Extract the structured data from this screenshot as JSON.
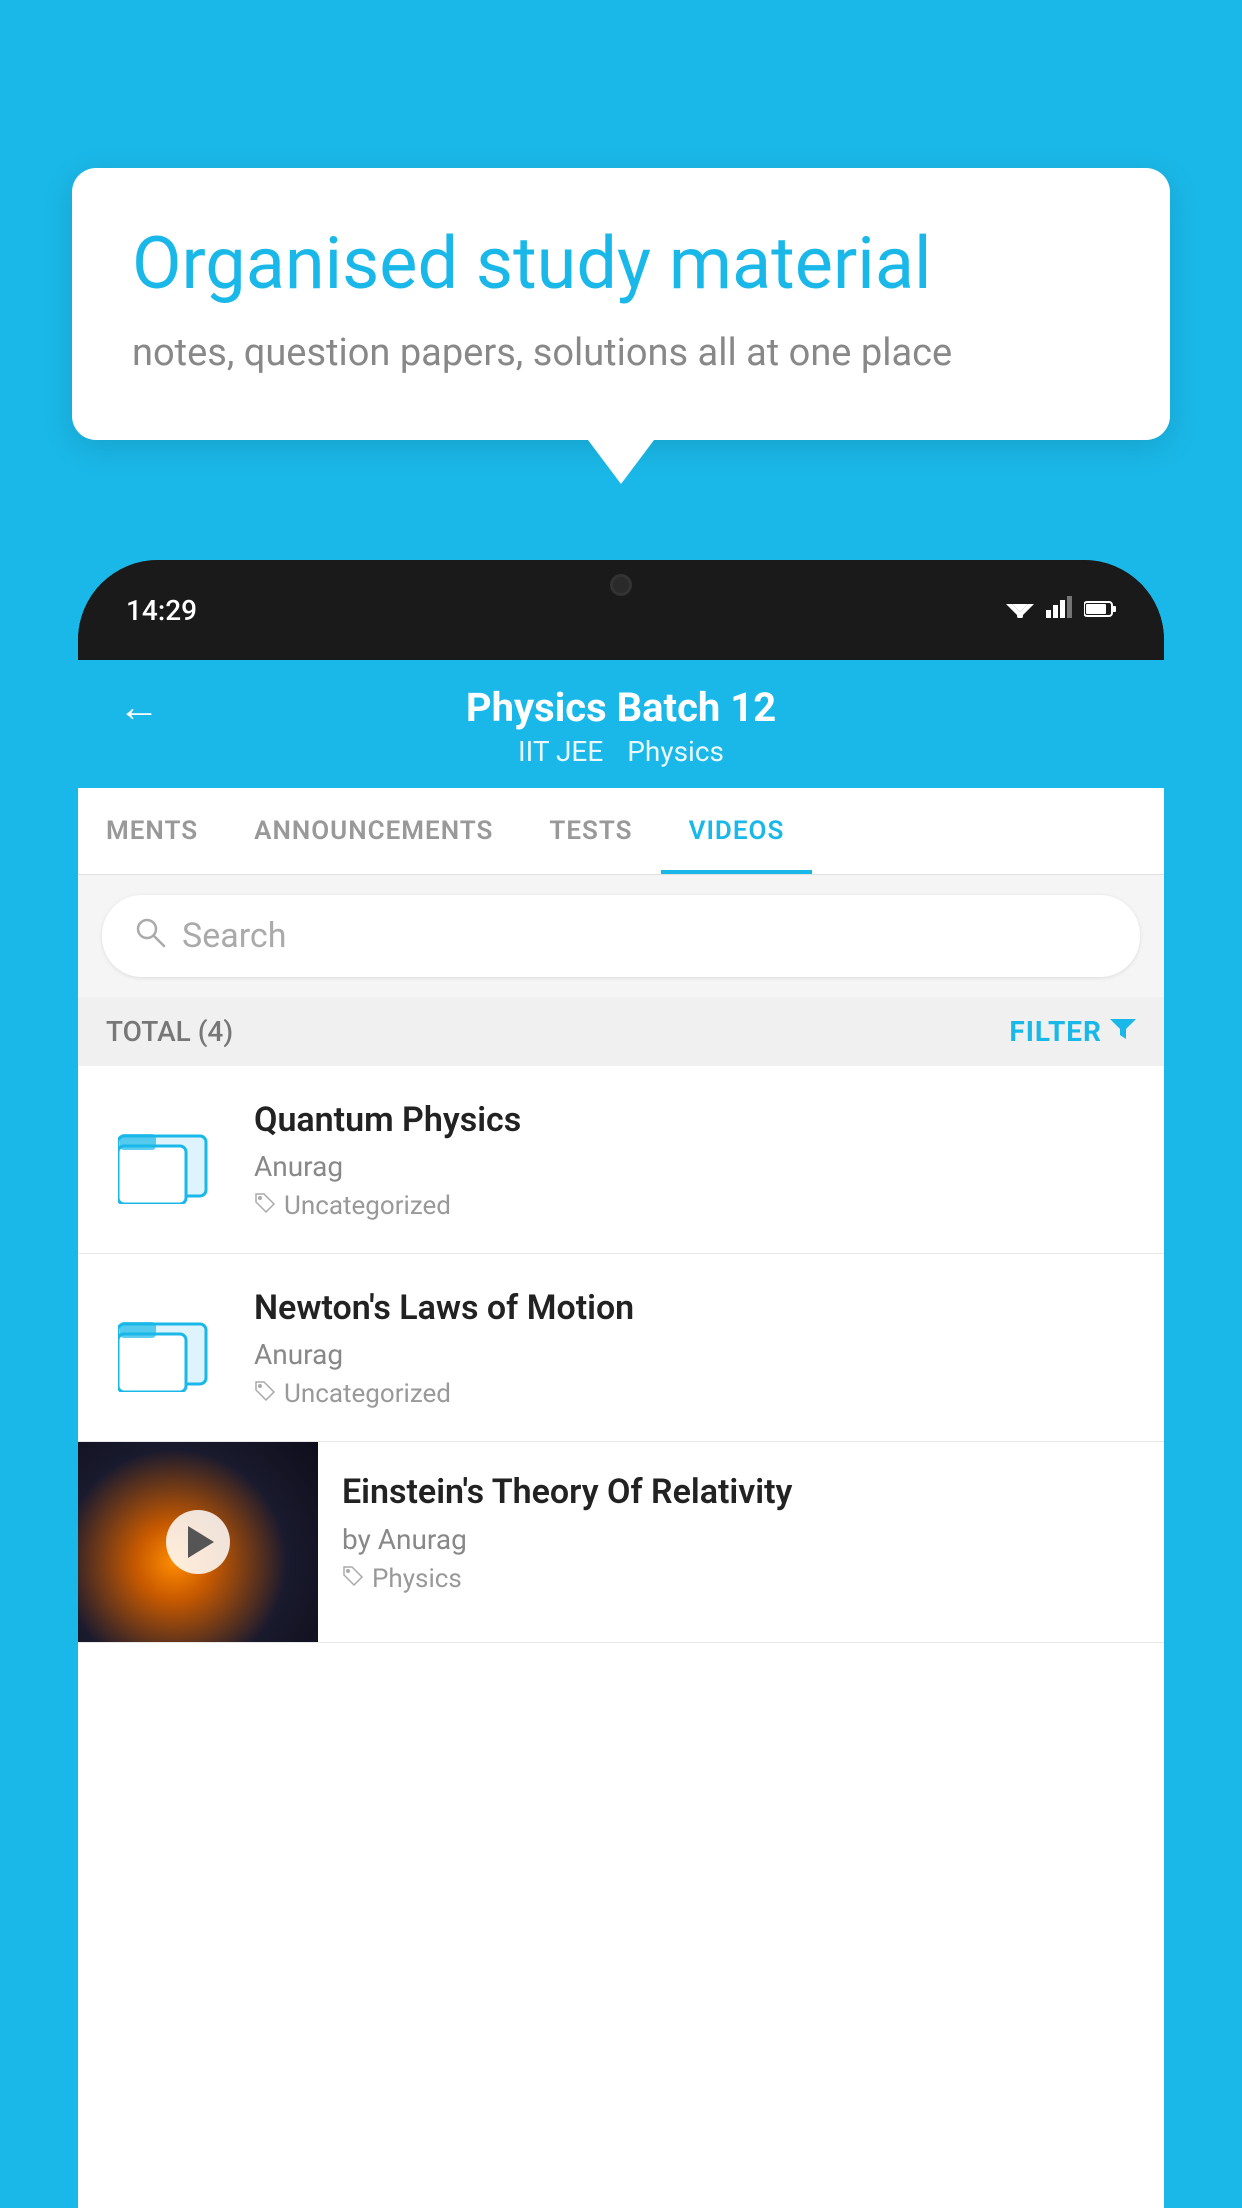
{
  "background_color": "#1ab8e8",
  "speech_bubble": {
    "heading": "Organised study material",
    "subtext": "notes, question papers, solutions all at one place"
  },
  "phone": {
    "status_bar": {
      "time": "14:29",
      "icons": [
        "wifi",
        "signal",
        "battery"
      ]
    },
    "header": {
      "back_label": "←",
      "title": "Physics Batch 12",
      "subtitle_left": "IIT JEE",
      "subtitle_right": "Physics"
    },
    "tabs": [
      {
        "label": "MENTS",
        "active": false
      },
      {
        "label": "ANNOUNCEMENTS",
        "active": false
      },
      {
        "label": "TESTS",
        "active": false
      },
      {
        "label": "VIDEOS",
        "active": true
      }
    ],
    "search": {
      "placeholder": "Search"
    },
    "filter_row": {
      "total_label": "TOTAL (4)",
      "filter_label": "FILTER"
    },
    "videos": [
      {
        "id": 1,
        "title": "Quantum Physics",
        "author": "Anurag",
        "tag": "Uncategorized",
        "has_thumbnail": false
      },
      {
        "id": 2,
        "title": "Newton's Laws of Motion",
        "author": "Anurag",
        "tag": "Uncategorized",
        "has_thumbnail": false
      },
      {
        "id": 3,
        "title": "Einstein's Theory Of Relativity",
        "author": "by Anurag",
        "tag": "Physics",
        "has_thumbnail": true
      }
    ]
  }
}
